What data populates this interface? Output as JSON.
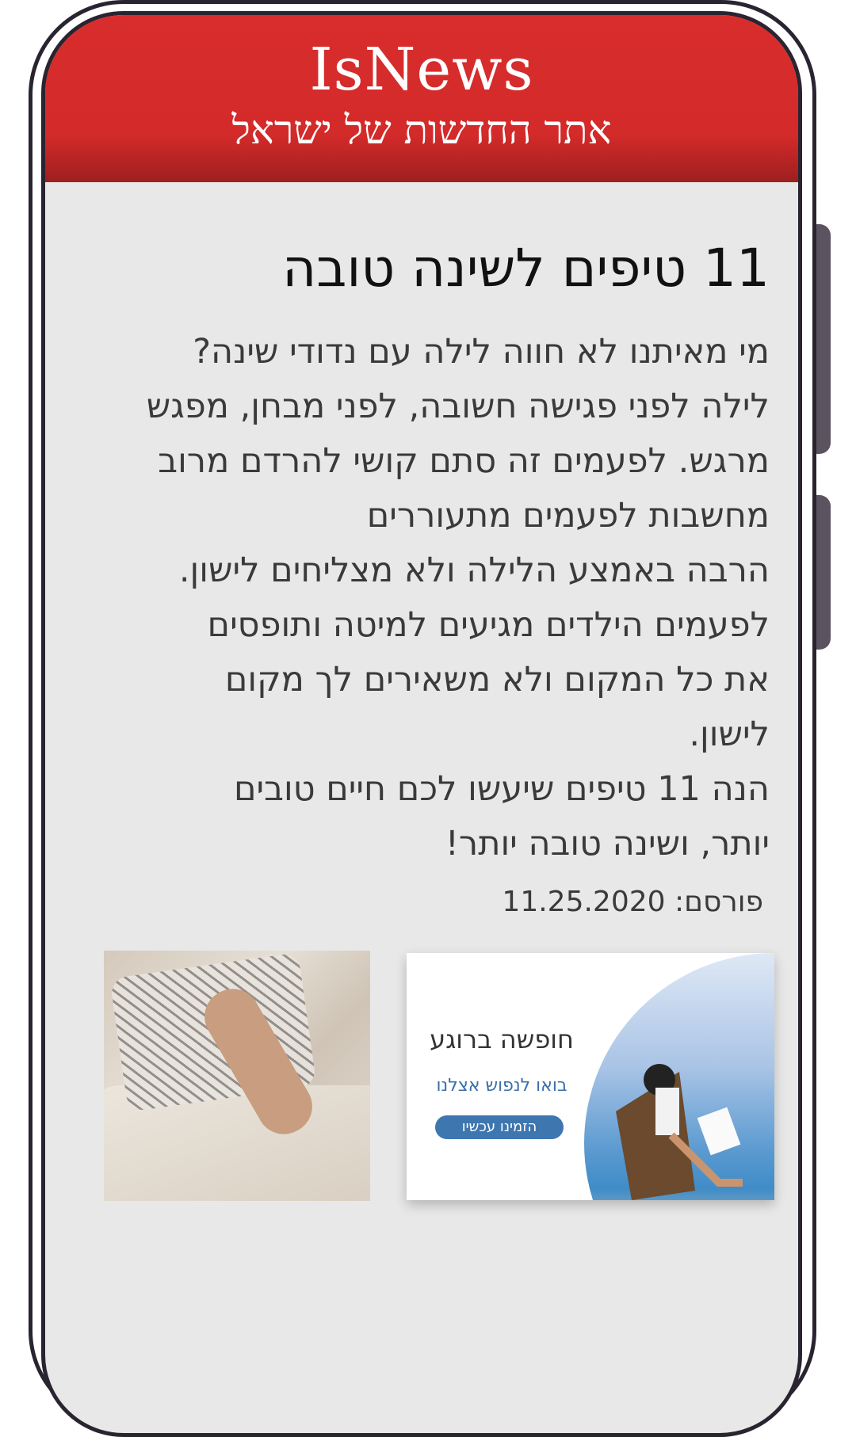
{
  "header": {
    "logo": "IsNews",
    "tagline": "אתר החדשות של ישראל"
  },
  "article": {
    "title": "11  טיפים לשינה טובה",
    "body": "מי מאיתנו לא חווה לילה עם נדודי שינה?\nלילה לפני פגישה חשובה, לפני מבחן, מפגש\nמרגש. לפעמים זה סתם קושי להרדם מרוב\nמחשבות לפעמים מתעוררים\nהרבה באמצע הלילה ולא מצליחים לישון.\nלפעמים הילדים מגיעים למיטה ותופסים\nאת כל המקום ולא משאירים לך מקום\nלישון.\nהנה 11 טיפים שיעשו לכם חיים טובים\nיותר, ושינה טובה יותר!",
    "published_label": "פורסם:",
    "published_date": "11.25.2020"
  },
  "ad": {
    "title": "חופשה ברוגע",
    "subtitle": "בואו לנפוש אצלנו",
    "button_label": "הזמינו עכשיו"
  },
  "colors": {
    "header_red": "#d92d2d",
    "background": "#e8e8e8",
    "ad_button": "#3e76b0",
    "ad_subtitle": "#3a6ea8"
  }
}
